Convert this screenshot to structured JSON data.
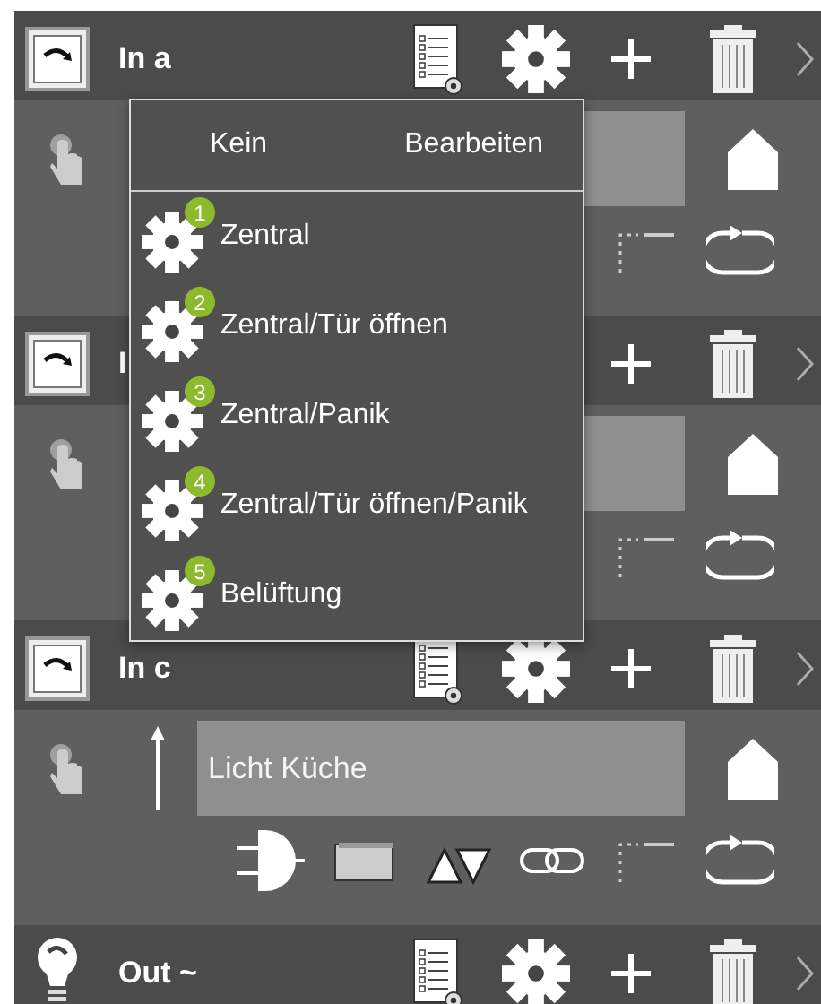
{
  "blocks": [
    {
      "kind": "input",
      "title": "In a"
    },
    {
      "kind": "input",
      "title": "I"
    },
    {
      "kind": "input",
      "title": "In c",
      "field": "Licht Küche"
    },
    {
      "kind": "output",
      "title": "Out ~"
    }
  ],
  "menu": {
    "buttons": [
      "Kein",
      "Bearbeiten"
    ],
    "items": [
      {
        "badge": "1",
        "label": "Zentral"
      },
      {
        "badge": "2",
        "label": "Zentral/Tür öffnen"
      },
      {
        "badge": "3",
        "label": "Zentral/Panik"
      },
      {
        "badge": "4",
        "label": "Zentral/Tür öffnen/Panik"
      },
      {
        "badge": "5",
        "label": "Belüftung"
      }
    ]
  }
}
